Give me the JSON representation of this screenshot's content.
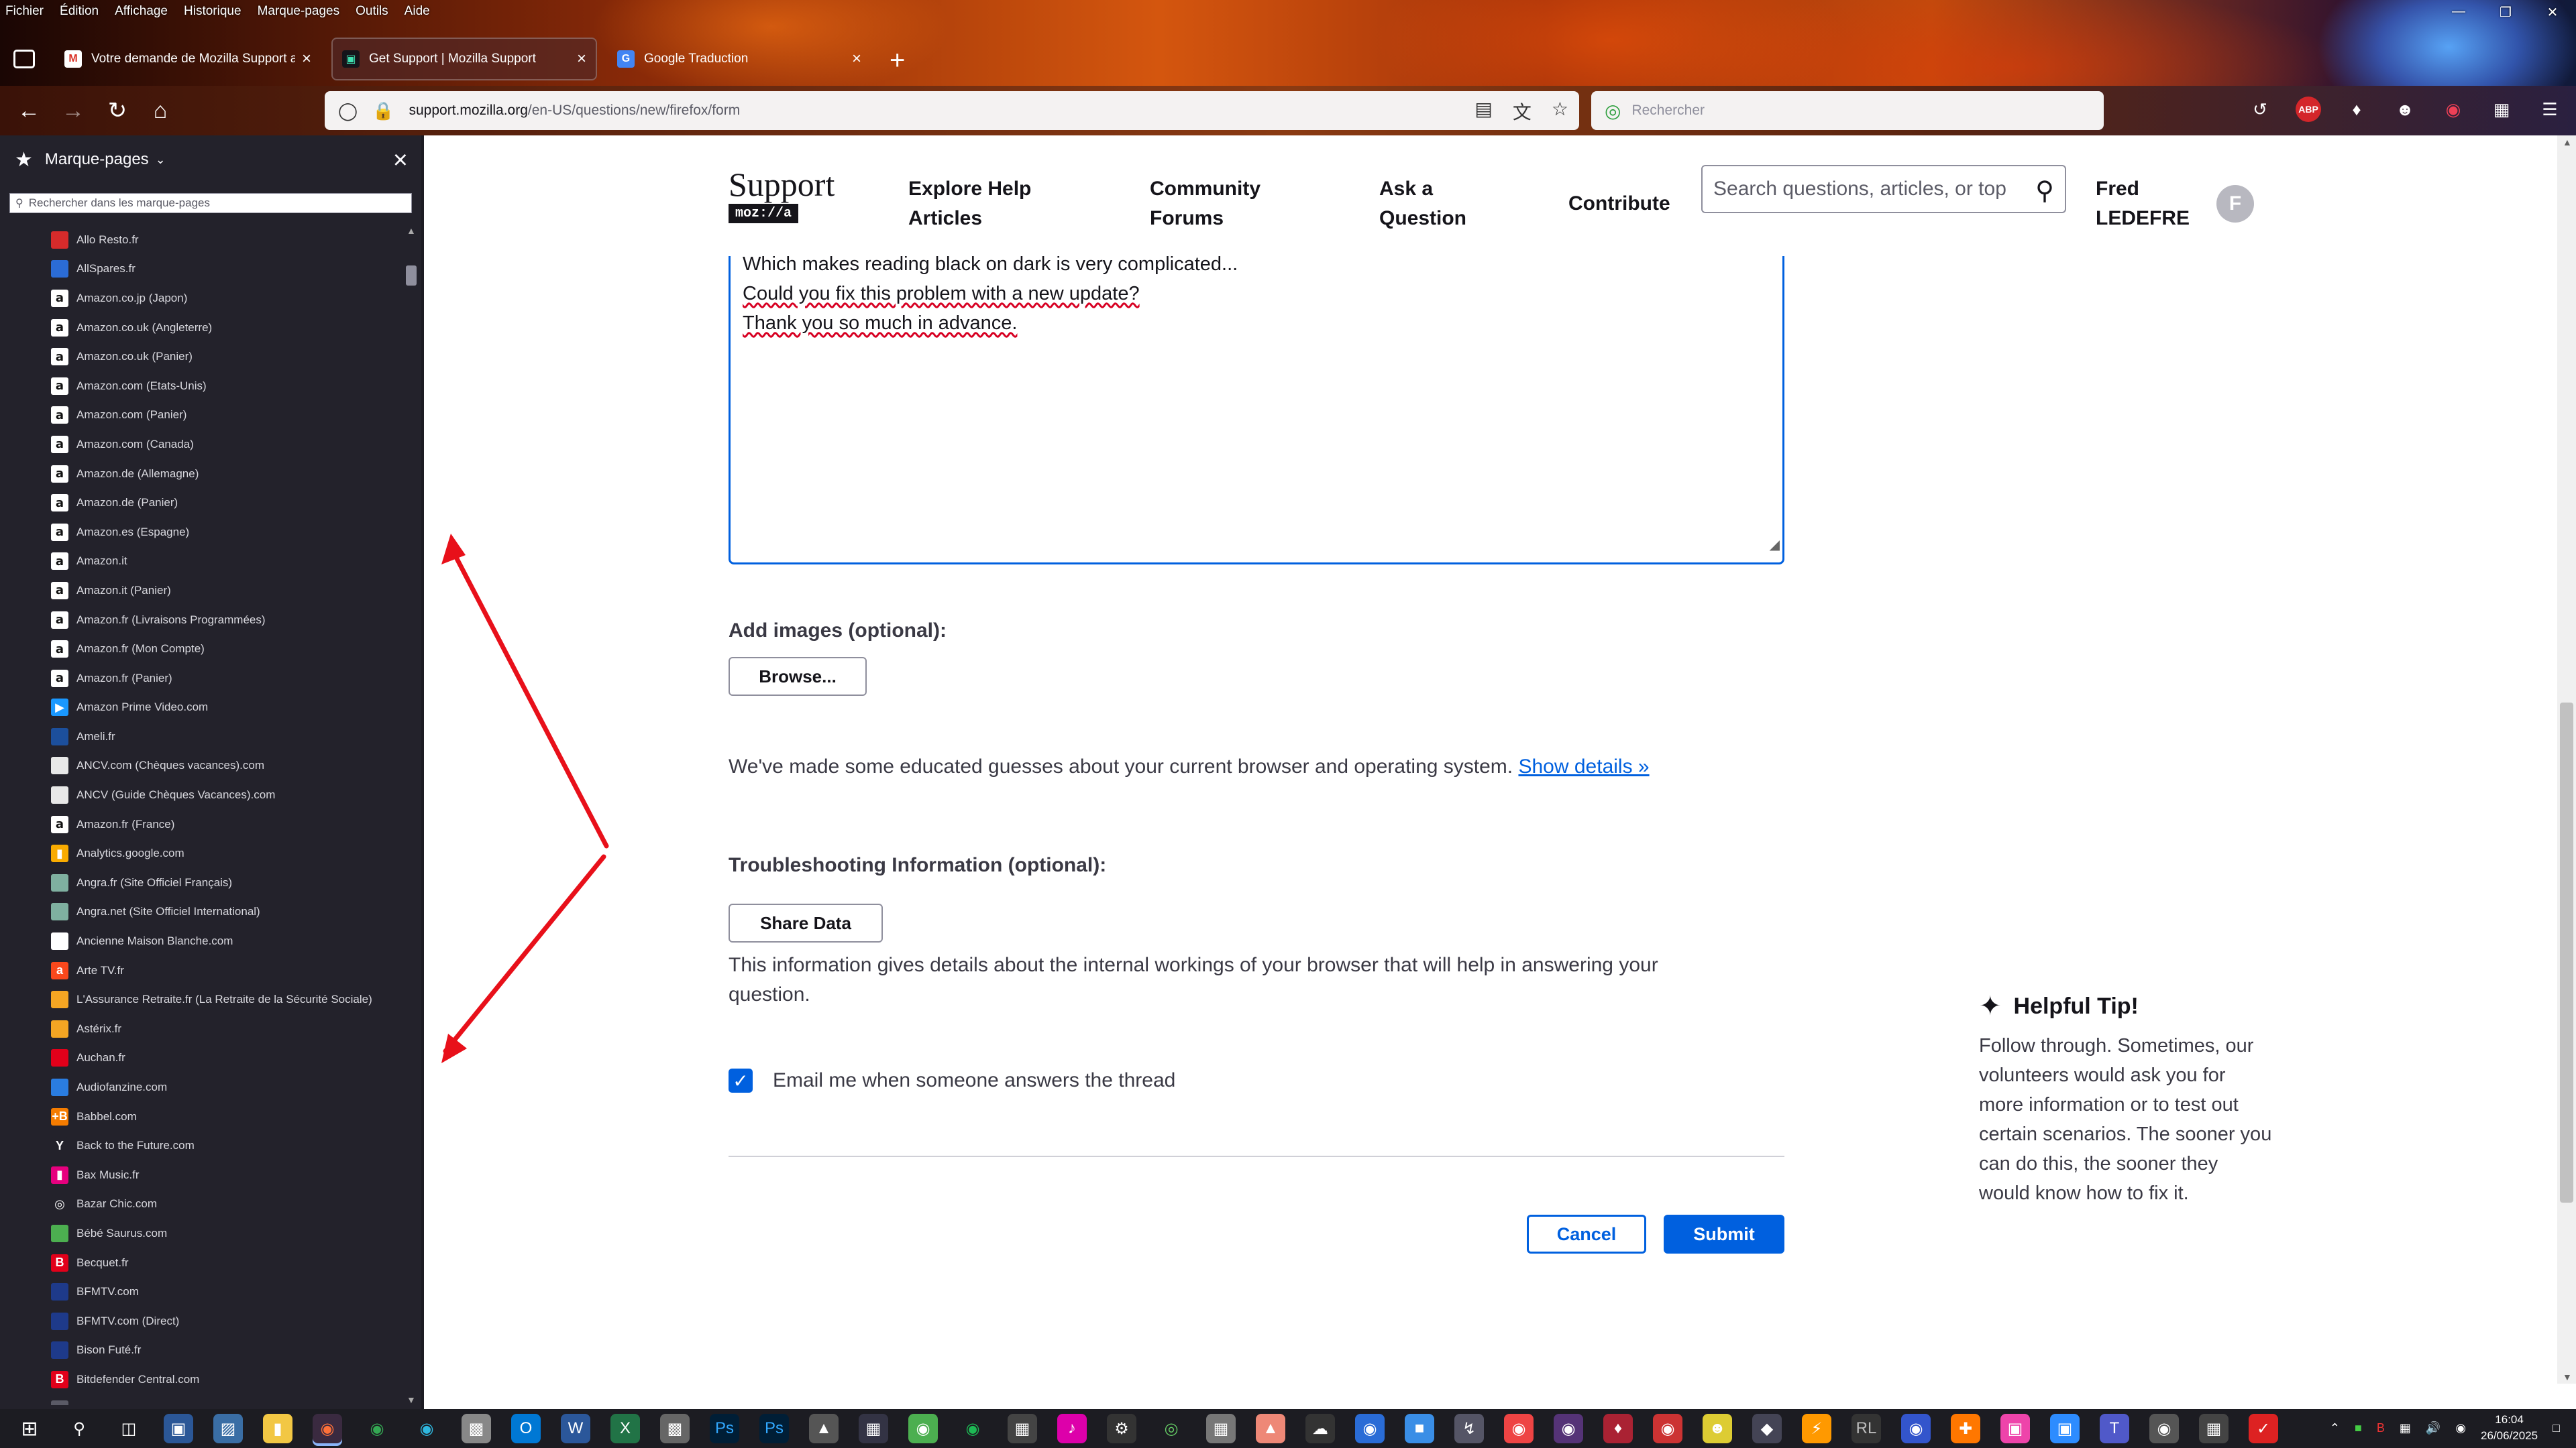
{
  "menubar": [
    "Fichier",
    "Édition",
    "Affichage",
    "Historique",
    "Marque-pages",
    "Outils",
    "Aide"
  ],
  "tabs": [
    {
      "title": "Votre demande de Mozilla Support a é",
      "favicon": "gmail-icon",
      "active": false
    },
    {
      "title": "Get Support | Mozilla Support",
      "favicon": "mozilla-support-icon",
      "active": true
    },
    {
      "title": "Google Traduction",
      "favicon": "google-translate-icon",
      "active": false
    }
  ],
  "url": {
    "domain": "support.mozilla.org",
    "path": "/en-US/questions/new/firefox/form"
  },
  "searchbar": {
    "placeholder": "Rechercher"
  },
  "sidebar": {
    "title": "Marque-pages",
    "search_placeholder": "Rechercher dans les marque-pages",
    "bookmarks": [
      {
        "label": "Allo Resto.fr",
        "color": "#d62b2b",
        "glyph": ""
      },
      {
        "label": "AllSpares.fr",
        "color": "#2b6cd6",
        "glyph": ""
      },
      {
        "label": "Amazon.co.jp (Japon)",
        "color": "amz",
        "glyph": "a"
      },
      {
        "label": "Amazon.co.uk (Angleterre)",
        "color": "amz",
        "glyph": "a"
      },
      {
        "label": "Amazon.co.uk (Panier)",
        "color": "amz",
        "glyph": "a"
      },
      {
        "label": "Amazon.com (Etats-Unis)",
        "color": "amz",
        "glyph": "a"
      },
      {
        "label": "Amazon.com (Panier)",
        "color": "amz",
        "glyph": "a"
      },
      {
        "label": "Amazon.com (Canada)",
        "color": "amz",
        "glyph": "a"
      },
      {
        "label": "Amazon.de (Allemagne)",
        "color": "amz",
        "glyph": "a"
      },
      {
        "label": "Amazon.de (Panier)",
        "color": "amz",
        "glyph": "a"
      },
      {
        "label": "Amazon.es (Espagne)",
        "color": "amz",
        "glyph": "a"
      },
      {
        "label": "Amazon.it",
        "color": "amz",
        "glyph": "a"
      },
      {
        "label": "Amazon.it (Panier)",
        "color": "amz",
        "glyph": "a"
      },
      {
        "label": "Amazon.fr (Livraisons Programmées)",
        "color": "amz",
        "glyph": "a"
      },
      {
        "label": "Amazon.fr (Mon Compte)",
        "color": "amz",
        "glyph": "a"
      },
      {
        "label": "Amazon.fr (Panier)",
        "color": "amz",
        "glyph": "a"
      },
      {
        "label": "Amazon Prime Video.com",
        "color": "#1a98ff",
        "glyph": "▶"
      },
      {
        "label": "Ameli.fr",
        "color": "#1c4f9c",
        "glyph": ""
      },
      {
        "label": "ANCV.com (Chèques vacances).com",
        "color": "#e8e8e8",
        "glyph": ""
      },
      {
        "label": "ANCV (Guide Chèques Vacances).com",
        "color": "#e8e8e8",
        "glyph": ""
      },
      {
        "label": "Amazon.fr (France)",
        "color": "amz",
        "glyph": "a"
      },
      {
        "label": "Analytics.google.com",
        "color": "#f9ab00",
        "glyph": "▮"
      },
      {
        "label": "Angra.fr (Site Officiel Français)",
        "color": "#7fb0a0",
        "glyph": ""
      },
      {
        "label": "Angra.net (Site Officiel International)",
        "color": "#7fb0a0",
        "glyph": ""
      },
      {
        "label": "Ancienne Maison Blanche.com",
        "color": "#ffffff",
        "glyph": ""
      },
      {
        "label": "Arte TV.fr",
        "color": "#fa481c",
        "glyph": "a"
      },
      {
        "label": "L'Assurance Retraite.fr (La Retraite de la Sécurité Sociale)",
        "color": "#f5a623",
        "glyph": ""
      },
      {
        "label": "Astérix.fr",
        "color": "#f5a623",
        "glyph": ""
      },
      {
        "label": "Auchan.fr",
        "color": "#e2001a",
        "glyph": ""
      },
      {
        "label": "Audiofanzine.com",
        "color": "#2a7de1",
        "glyph": ""
      },
      {
        "label": "Babbel.com",
        "color": "#f57c00",
        "glyph": "+B"
      },
      {
        "label": "Back to the Future.com",
        "color": "#23222b",
        "glyph": "Y"
      },
      {
        "label": "Bax Music.fr",
        "color": "#e6007e",
        "glyph": "▮"
      },
      {
        "label": "Bazar Chic.com",
        "color": "#23222b",
        "glyph": "◎"
      },
      {
        "label": "Bébé Saurus.com",
        "color": "#4caf50",
        "glyph": ""
      },
      {
        "label": "Becquet.fr",
        "color": "#e2001a",
        "glyph": "B"
      },
      {
        "label": "BFMTV.com",
        "color": "#1e3a8a",
        "glyph": ""
      },
      {
        "label": "BFMTV.com (Direct)",
        "color": "#1e3a8a",
        "glyph": ""
      },
      {
        "label": "Bison Futé.fr",
        "color": "#1e3a8a",
        "glyph": ""
      },
      {
        "label": "Bitdefender Central.com",
        "color": "#e2001a",
        "glyph": "B"
      },
      {
        "label": "",
        "color": "#5a5a66",
        "glyph": ""
      }
    ]
  },
  "site": {
    "logo_main": "Support",
    "logo_badge": "moz://a",
    "nav": {
      "explore_line1": "Explore Help",
      "explore_line2": "Articles",
      "community_line1": "Community",
      "community_line2": "Forums",
      "ask_line1": "Ask a",
      "ask_line2": "Question",
      "contribute": "Contribute"
    },
    "search_placeholder": "Search questions, articles, or top",
    "user_line1": "Fred",
    "user_line2": "LEDEFRE",
    "avatar_letter": "F"
  },
  "form": {
    "textarea_lines": [
      "Which makes reading black on dark is very complicated...",
      "Could you fix this problem with a new update?",
      "Thank you so much in advance."
    ],
    "add_images_label": "Add images (optional):",
    "browse_label": "Browse...",
    "guesses_text": "We've made some educated guesses about your current browser and operating system.",
    "show_details_link": "Show details »",
    "troubleshooting_label": "Troubleshooting Information (optional):",
    "share_data_label": "Share Data",
    "troubleshooting_text_line1": "This information gives details about the internal workings of your browser that will help in answering your",
    "troubleshooting_text_line2": "question.",
    "email_checkbox_label": "Email me when someone answers the thread",
    "email_checked": true,
    "cancel_label": "Cancel",
    "submit_label": "Submit"
  },
  "tip": {
    "title": "Helpful Tip!",
    "body": "Follow through. Sometimes, our volunteers would ask you for more information or to test out certain scenarios. The sooner you can do this, the sooner they would know how to fix it."
  },
  "taskbar": {
    "time": "16:04",
    "date": "26/06/2025"
  },
  "colors": {
    "accent": "#0060df",
    "annotation_arrow": "#e8101a",
    "sidebar_bg": "#23222b"
  }
}
